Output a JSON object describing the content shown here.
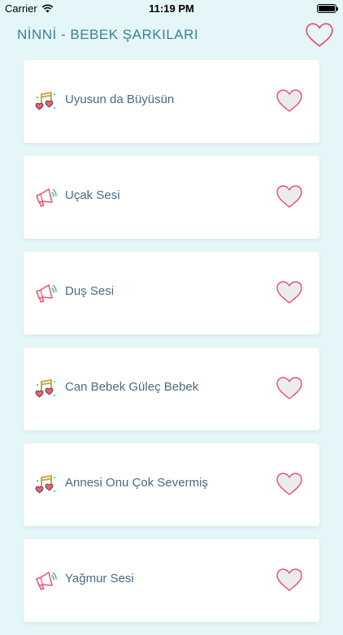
{
  "status_bar": {
    "carrier": "Carrier",
    "time": "11:19 PM",
    "battery_level": 1.0
  },
  "header": {
    "title": "NİNNİ - BEBEK ŞARKILARI",
    "favorite_icon": "heart-outline-icon"
  },
  "items": [
    {
      "label": "Uyusun da Büyüsün",
      "icon": "music-note-hearts-icon"
    },
    {
      "label": "Uçak Sesi",
      "icon": "speaker-icon"
    },
    {
      "label": "Duş Sesi",
      "icon": "speaker-icon"
    },
    {
      "label": "Can Bebek Güleç Bebek",
      "icon": "music-note-hearts-icon"
    },
    {
      "label": "Annesi Onu Çok Severmiş",
      "icon": "music-note-hearts-icon"
    },
    {
      "label": "Yağmur Sesi",
      "icon": "speaker-icon"
    }
  ],
  "colors": {
    "background": "#e4f6f8",
    "title": "#3e7f9b",
    "label": "#4a6a84",
    "heart_stroke": "#e8506e",
    "heart_fill": "#ececec",
    "music_note": "#c9a94a"
  }
}
